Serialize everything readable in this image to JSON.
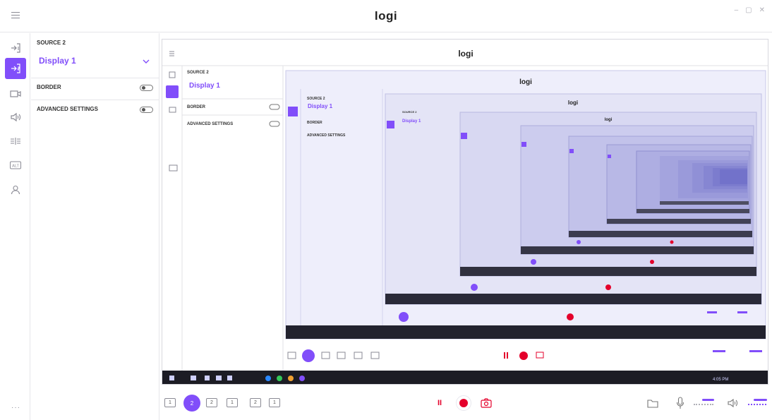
{
  "app": {
    "logo": "logi"
  },
  "window_controls": [
    "–",
    "▢",
    "✕"
  ],
  "rail": {
    "items": [
      {
        "name": "input-1-icon",
        "active": false
      },
      {
        "name": "input-2-icon",
        "active": true
      },
      {
        "name": "camera-icon",
        "active": false
      },
      {
        "name": "speaker-icon",
        "active": false
      },
      {
        "name": "transitions-icon",
        "active": false
      },
      {
        "name": "alt-icon",
        "active": false,
        "label": "ALT"
      },
      {
        "name": "user-icon",
        "active": false
      }
    ],
    "more": "···"
  },
  "panel": {
    "source_label": "SOURCE 2",
    "source_value": "Display 1",
    "options": [
      {
        "label": "BORDER",
        "on": false
      },
      {
        "label": "ADVANCED SETTINGS",
        "on": false
      }
    ]
  },
  "toolbar": {
    "layouts": [
      "1",
      "2",
      "2",
      "1",
      "2",
      "1"
    ],
    "active_layout": 1,
    "pause_label": "II",
    "camera": "camera-icon",
    "folder": "folder-icon",
    "mic": "microphone-icon",
    "speaker": "speaker-icon"
  },
  "colors": {
    "accent": "#814efa",
    "record": "#e4002b",
    "border": "#e6e6ea"
  }
}
